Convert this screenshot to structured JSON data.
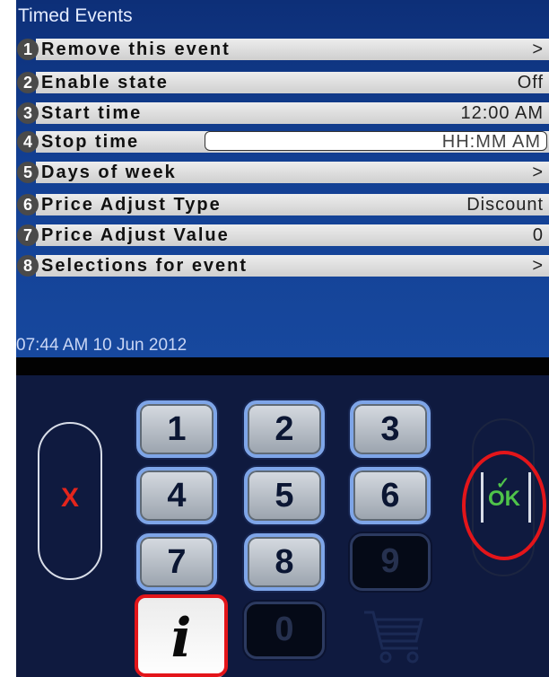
{
  "title": "Timed Events",
  "menu": [
    {
      "num": "1",
      "label": "Remove this event",
      "value": ">"
    },
    {
      "num": "2",
      "label": "Enable state",
      "value": "Off"
    },
    {
      "num": "3",
      "label": "Start time",
      "value": "12:00 AM"
    },
    {
      "num": "4",
      "label": "Stop time",
      "value": "",
      "placeholder": "HH:MM AM"
    },
    {
      "num": "5",
      "label": "Days of week",
      "value": ">"
    },
    {
      "num": "6",
      "label": "Price Adjust Type",
      "value": "Discount"
    },
    {
      "num": "7",
      "label": "Price Adjust Value",
      "value": "0"
    },
    {
      "num": "8",
      "label": "Selections for event",
      "value": ">"
    }
  ],
  "datetime": "07:44 AM 10 Jun 2012",
  "keypad": {
    "keys": [
      "1",
      "2",
      "3",
      "4",
      "5",
      "6",
      "7",
      "8",
      "9",
      "0"
    ],
    "disabled": [
      "9",
      "0"
    ],
    "cancel_label": "X",
    "ok_label": "OK",
    "ok_check": "✓",
    "info_label": "i"
  },
  "icons": {
    "cart": "shopping-cart-icon",
    "info": "info-icon",
    "cancel": "close-icon",
    "ok": "checkmark-icon"
  },
  "colors": {
    "header_bg": "#123f92",
    "keypad_bg": "#0f1a3f",
    "cancel": "#e3251c",
    "ok": "#4fc34a",
    "highlight": "#e3151a"
  }
}
